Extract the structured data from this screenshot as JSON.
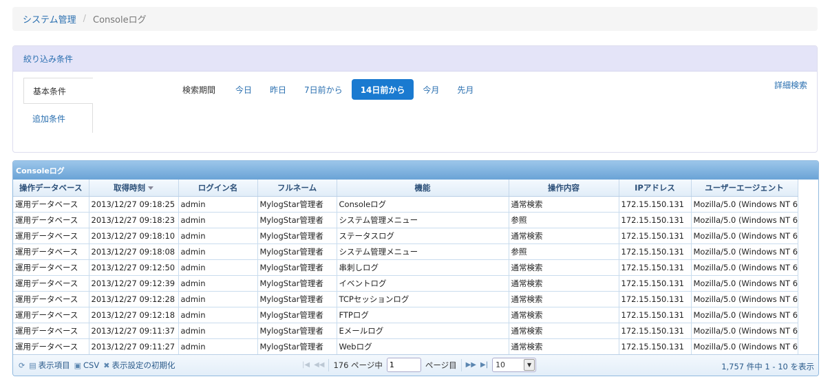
{
  "breadcrumb": {
    "parent": "システム管理",
    "separator": "/",
    "current": "Consoleログ"
  },
  "filter": {
    "title": "絞り込み条件",
    "tabs": [
      "基本条件",
      "追加条件"
    ],
    "period_label": "検索期間",
    "period_options": [
      "今日",
      "昨日",
      "7日前から",
      "14日前から",
      "今月",
      "先月"
    ],
    "period_selected": "14日前から",
    "detail_link": "詳細検索"
  },
  "grid": {
    "title": "Consoleログ",
    "columns": [
      "操作データベース",
      "取得時刻",
      "ログイン名",
      "フルネーム",
      "機能",
      "操作内容",
      "IPアドレス",
      "ユーザーエージェント"
    ],
    "rows": [
      [
        "運用データベース",
        "2013/12/27 09:18:25",
        "admin",
        "MylogStar管理者",
        "Consoleログ",
        "通常検索",
        "172.15.150.131",
        "Mozilla/5.0 (Windows NT 6."
      ],
      [
        "運用データベース",
        "2013/12/27 09:18:23",
        "admin",
        "MylogStar管理者",
        "システム管理メニュー",
        "参照",
        "172.15.150.131",
        "Mozilla/5.0 (Windows NT 6."
      ],
      [
        "運用データベース",
        "2013/12/27 09:18:10",
        "admin",
        "MylogStar管理者",
        "ステータスログ",
        "通常検索",
        "172.15.150.131",
        "Mozilla/5.0 (Windows NT 6."
      ],
      [
        "運用データベース",
        "2013/12/27 09:18:08",
        "admin",
        "MylogStar管理者",
        "システム管理メニュー",
        "参照",
        "172.15.150.131",
        "Mozilla/5.0 (Windows NT 6."
      ],
      [
        "運用データベース",
        "2013/12/27 09:12:50",
        "admin",
        "MylogStar管理者",
        "串刺しログ",
        "通常検索",
        "172.15.150.131",
        "Mozilla/5.0 (Windows NT 6."
      ],
      [
        "運用データベース",
        "2013/12/27 09:12:39",
        "admin",
        "MylogStar管理者",
        "イベントログ",
        "通常検索",
        "172.15.150.131",
        "Mozilla/5.0 (Windows NT 6."
      ],
      [
        "運用データベース",
        "2013/12/27 09:12:28",
        "admin",
        "MylogStar管理者",
        "TCPセッションログ",
        "通常検索",
        "172.15.150.131",
        "Mozilla/5.0 (Windows NT 6."
      ],
      [
        "運用データベース",
        "2013/12/27 09:12:18",
        "admin",
        "MylogStar管理者",
        "FTPログ",
        "通常検索",
        "172.15.150.131",
        "Mozilla/5.0 (Windows NT 6."
      ],
      [
        "運用データベース",
        "2013/12/27 09:11:37",
        "admin",
        "MylogStar管理者",
        "Eメールログ",
        "通常検索",
        "172.15.150.131",
        "Mozilla/5.0 (Windows NT 6."
      ],
      [
        "運用データベース",
        "2013/12/27 09:11:27",
        "admin",
        "MylogStar管理者",
        "Webログ",
        "通常検索",
        "172.15.150.131",
        "Mozilla/5.0 (Windows NT 6."
      ]
    ]
  },
  "pager": {
    "display_items": "表示項目",
    "csv": "CSV",
    "reset": "表示設定の初期化",
    "total_pages_text": "176 ページ中",
    "page_value": "1",
    "page_suffix": "ページ目",
    "page_size": "10",
    "summary": "1,757 件中 1 - 10 を表示"
  }
}
